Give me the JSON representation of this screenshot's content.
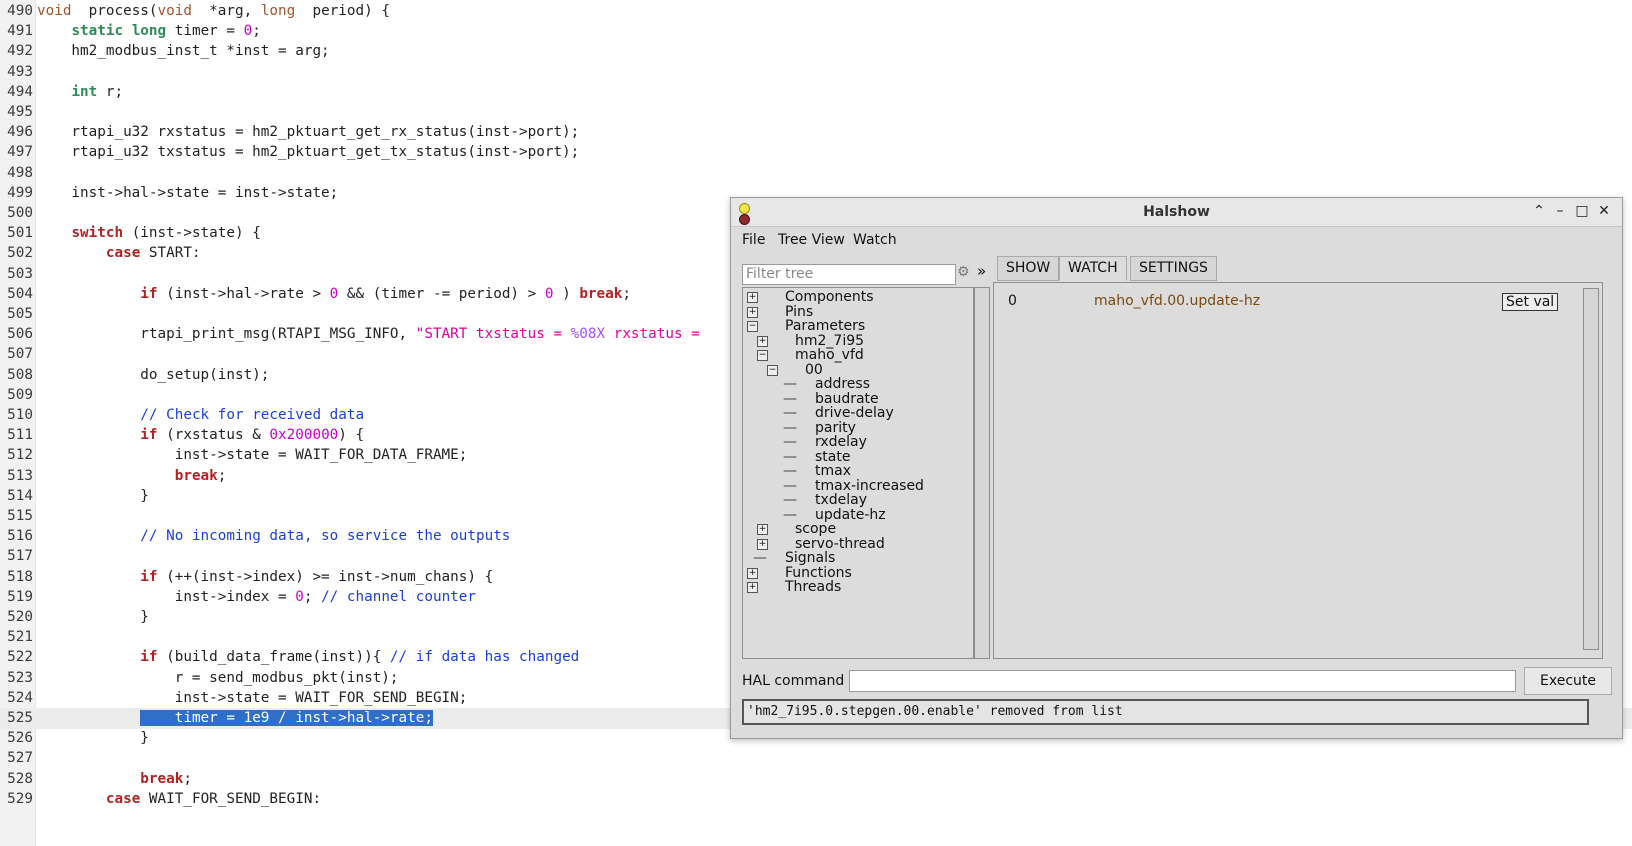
{
  "editor": {
    "lines": [
      {
        "n": "490",
        "segs": [
          [
            "kw",
            "void"
          ],
          [
            "",
            "  process("
          ],
          [
            "kw",
            "void"
          ],
          [
            "",
            "  *arg, "
          ],
          [
            "kw",
            "long"
          ],
          [
            "",
            "  period) {"
          ]
        ]
      },
      {
        "n": "491",
        "segs": [
          [
            "",
            "    "
          ],
          [
            "kwt",
            "static"
          ],
          [
            "",
            " "
          ],
          [
            "kwt",
            "long"
          ],
          [
            "",
            " timer = "
          ],
          [
            "num",
            "0"
          ],
          [
            "",
            ";"
          ]
        ]
      },
      {
        "n": "492",
        "segs": [
          [
            "",
            "    hm2_modbus_inst_t *inst = arg;"
          ]
        ]
      },
      {
        "n": "493",
        "segs": []
      },
      {
        "n": "494",
        "segs": [
          [
            "",
            "    "
          ],
          [
            "kwt",
            "int"
          ],
          [
            "",
            " r;"
          ]
        ]
      },
      {
        "n": "495",
        "segs": []
      },
      {
        "n": "496",
        "segs": [
          [
            "",
            "    rtapi_u32 rxstatus = hm2_pktuart_get_rx_status(inst->port);"
          ]
        ]
      },
      {
        "n": "497",
        "segs": [
          [
            "",
            "    rtapi_u32 txstatus = hm2_pktuart_get_tx_status(inst->port);"
          ]
        ]
      },
      {
        "n": "498",
        "segs": []
      },
      {
        "n": "499",
        "segs": [
          [
            "",
            "    inst->hal->state = inst->state;"
          ]
        ]
      },
      {
        "n": "500",
        "segs": []
      },
      {
        "n": "501",
        "segs": [
          [
            "",
            "    "
          ],
          [
            "kw3",
            "switch"
          ],
          [
            "",
            " (inst->state) {"
          ]
        ]
      },
      {
        "n": "502",
        "segs": [
          [
            "",
            "        "
          ],
          [
            "kw3",
            "case"
          ],
          [
            "",
            " START:"
          ]
        ]
      },
      {
        "n": "503",
        "segs": []
      },
      {
        "n": "504",
        "segs": [
          [
            "",
            "            "
          ],
          [
            "kw3",
            "if"
          ],
          [
            "",
            " (inst->hal->rate > "
          ],
          [
            "num",
            "0"
          ],
          [
            "",
            " && (timer -= period) > "
          ],
          [
            "num",
            "0"
          ],
          [
            "",
            " ) "
          ],
          [
            "kw3",
            "break"
          ],
          [
            "",
            ";"
          ]
        ]
      },
      {
        "n": "505",
        "segs": []
      },
      {
        "n": "506",
        "segs": [
          [
            "",
            "            rtapi_print_msg(RTAPI_MSG_INFO, "
          ],
          [
            "str",
            "\"START txstatus = "
          ],
          [
            "fmt",
            "%08X"
          ],
          [
            "str",
            " rxstatus = "
          ]
        ]
      },
      {
        "n": "507",
        "segs": []
      },
      {
        "n": "508",
        "segs": [
          [
            "",
            "            do_setup(inst);"
          ]
        ]
      },
      {
        "n": "509",
        "segs": []
      },
      {
        "n": "510",
        "segs": [
          [
            "",
            "            "
          ],
          [
            "cmt",
            "// Check for received data"
          ]
        ]
      },
      {
        "n": "511",
        "segs": [
          [
            "",
            "            "
          ],
          [
            "kw3",
            "if"
          ],
          [
            "",
            " (rxstatus & "
          ],
          [
            "num",
            "0x200000"
          ],
          [
            "",
            ") {"
          ]
        ]
      },
      {
        "n": "512",
        "segs": [
          [
            "",
            "                inst->state = WAIT_FOR_DATA_FRAME;"
          ]
        ]
      },
      {
        "n": "513",
        "segs": [
          [
            "",
            "                "
          ],
          [
            "kw3",
            "break"
          ],
          [
            "",
            ";"
          ]
        ]
      },
      {
        "n": "514",
        "segs": [
          [
            "",
            "            }"
          ]
        ]
      },
      {
        "n": "515",
        "segs": []
      },
      {
        "n": "516",
        "segs": [
          [
            "",
            "            "
          ],
          [
            "cmt",
            "// No incoming data, so service the outputs"
          ]
        ]
      },
      {
        "n": "517",
        "segs": []
      },
      {
        "n": "518",
        "segs": [
          [
            "",
            "            "
          ],
          [
            "kw3",
            "if"
          ],
          [
            "",
            " (++(inst->index) >= inst->num_chans) {"
          ]
        ]
      },
      {
        "n": "519",
        "segs": [
          [
            "",
            "                inst->index = "
          ],
          [
            "num",
            "0"
          ],
          [
            "",
            "; "
          ],
          [
            "cmt",
            "// channel counter"
          ]
        ]
      },
      {
        "n": "520",
        "segs": [
          [
            "",
            "            }"
          ]
        ]
      },
      {
        "n": "521",
        "segs": []
      },
      {
        "n": "522",
        "segs": [
          [
            "",
            "            "
          ],
          [
            "kw3",
            "if"
          ],
          [
            "",
            " (build_data_frame(inst)){ "
          ],
          [
            "cmt",
            "// if data has changed"
          ]
        ]
      },
      {
        "n": "523",
        "segs": [
          [
            "",
            "                r = send_modbus_pkt(inst);"
          ]
        ]
      },
      {
        "n": "524",
        "segs": [
          [
            "",
            "                inst->state = WAIT_FOR_SEND_BEGIN;"
          ]
        ]
      },
      {
        "n": "525",
        "current": true,
        "segs": [
          [
            "",
            "            "
          ],
          [
            "sel",
            "    timer = 1e9 / inst->hal->rate;"
          ]
        ]
      },
      {
        "n": "526",
        "segs": [
          [
            "",
            "            }"
          ]
        ]
      },
      {
        "n": "527",
        "segs": []
      },
      {
        "n": "528",
        "segs": [
          [
            "",
            "            "
          ],
          [
            "kw3",
            "break"
          ],
          [
            "",
            ";"
          ]
        ]
      },
      {
        "n": "529",
        "segs": [
          [
            "",
            "        "
          ],
          [
            "kw3",
            "case"
          ],
          [
            "",
            " WAIT_FOR_SEND_BEGIN:"
          ]
        ]
      }
    ]
  },
  "halshow": {
    "title": "Halshow",
    "menus": [
      "File",
      "Tree View",
      "Watch"
    ],
    "filter_placeholder": "Filter tree",
    "chevron": "»",
    "tabs": [
      "SHOW",
      "WATCH",
      "SETTINGS"
    ],
    "tree": [
      {
        "label": "Components",
        "level": 0,
        "box": "+"
      },
      {
        "label": "Pins",
        "level": 0,
        "box": "+"
      },
      {
        "label": "Parameters",
        "level": 0,
        "box": "-"
      },
      {
        "label": "hm2_7i95",
        "level": 1,
        "box": "+"
      },
      {
        "label": "maho_vfd",
        "level": 1,
        "box": "-"
      },
      {
        "label": "00",
        "level": 2,
        "box": "-"
      },
      {
        "label": "address",
        "level": 3,
        "box": ""
      },
      {
        "label": "baudrate",
        "level": 3,
        "box": ""
      },
      {
        "label": "drive-delay",
        "level": 3,
        "box": ""
      },
      {
        "label": "parity",
        "level": 3,
        "box": ""
      },
      {
        "label": "rxdelay",
        "level": 3,
        "box": ""
      },
      {
        "label": "state",
        "level": 3,
        "box": ""
      },
      {
        "label": "tmax",
        "level": 3,
        "box": ""
      },
      {
        "label": "tmax-increased",
        "level": 3,
        "box": ""
      },
      {
        "label": "txdelay",
        "level": 3,
        "box": ""
      },
      {
        "label": "update-hz",
        "level": 3,
        "box": ""
      },
      {
        "label": "scope",
        "level": 1,
        "box": "+"
      },
      {
        "label": "servo-thread",
        "level": 1,
        "box": "+"
      },
      {
        "label": "Signals",
        "level": 0,
        "box": ""
      },
      {
        "label": "Functions",
        "level": 0,
        "box": "+"
      },
      {
        "label": "Threads",
        "level": 0,
        "box": "+"
      }
    ],
    "watch": {
      "value": "0",
      "name": "maho_vfd.00.update-hz",
      "set_label": "Set val"
    },
    "hal_command_label": "HAL command :",
    "execute_label": "Execute",
    "status": "'hm2_7i95.0.stepgen.00.enable' removed from list"
  }
}
